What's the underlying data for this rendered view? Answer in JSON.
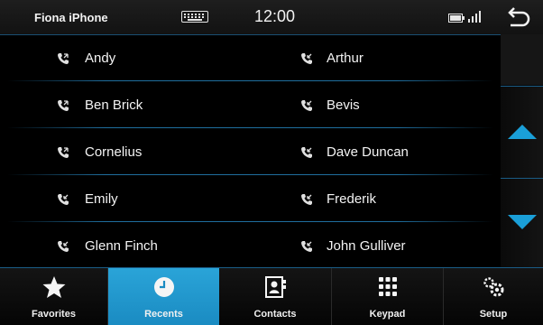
{
  "status": {
    "device_name": "Fiona iPhone",
    "time": "12:00"
  },
  "contacts": [
    {
      "left": "Andy",
      "right": "Arthur"
    },
    {
      "left": "Ben Brick",
      "right": "Bevis"
    },
    {
      "left": "Cornelius",
      "right": "Dave Duncan"
    },
    {
      "left": "Emily",
      "right": "Frederik"
    },
    {
      "left": "Glenn Finch",
      "right": "John Gulliver"
    }
  ],
  "tabs": [
    {
      "label": "Favorites",
      "icon": "star-icon"
    },
    {
      "label": "Recents",
      "icon": "clock-icon",
      "active": true
    },
    {
      "label": "Contacts",
      "icon": "contact-card-icon"
    },
    {
      "label": "Keypad",
      "icon": "keypad-icon"
    },
    {
      "label": "Setup",
      "icon": "gears-icon"
    }
  ],
  "colors": {
    "accent": "#1a8bc2",
    "divider": "#1f6e9e",
    "background": "#000000"
  }
}
